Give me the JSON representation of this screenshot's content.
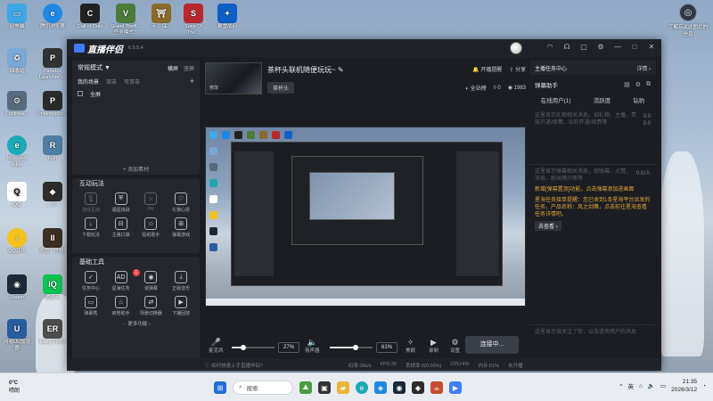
{
  "colors": {
    "accent": "#3f7cff",
    "highlight": "#e0a83a",
    "panel": "#24272e"
  },
  "desktop": {
    "icons": [
      {
        "label": "此电脑",
        "icon": "computer-icon"
      },
      {
        "label": "腾讯浏览器",
        "icon": "browser-icon"
      },
      {
        "label": "Call of Duty",
        "icon": "game-icon"
      },
      {
        "label": "Grand Theft... 任务模式...",
        "icon": "game-icon"
      },
      {
        "label": "天... 保...",
        "icon": "game-icon"
      },
      {
        "label": "Sons Of The...",
        "icon": "game-icon"
      },
      {
        "label": "暴雪战网",
        "icon": "app-icon"
      },
      {
        "label": "回收站",
        "icon": "recycle-bin-icon"
      },
      {
        "label": "Paradox Launcher v2",
        "icon": "app-icon"
      },
      {
        "label": "Controlle...",
        "icon": "app-icon"
      },
      {
        "label": "Phasmopho...",
        "icon": "game-icon"
      },
      {
        "label": "Microsoft Edge",
        "icon": "edge-icon"
      },
      {
        "label": "Raft",
        "icon": "game-icon"
      },
      {
        "label": "QQ",
        "icon": "qq-icon"
      },
      {
        "label": "... 小...",
        "icon": "app-icon"
      },
      {
        "label": "QQ音乐",
        "icon": "music-icon"
      },
      {
        "label": "天国：拯救2",
        "icon": "game-icon"
      },
      {
        "label": "Steam",
        "icon": "steam-icon"
      },
      {
        "label": "爱奇艺",
        "icon": "video-icon"
      },
      {
        "label": "网易UU加速器",
        "icon": "app-icon"
      },
      {
        "label": "Easy Red 2",
        "icon": "game-icon"
      }
    ],
    "right_icon": {
      "label": "了解有关此图片的信息",
      "icon": "camera-icon"
    }
  },
  "app": {
    "name": "直播伴侣",
    "version": "6.5.5.4",
    "window_controls": [
      "headset-icon",
      "customer-service-icon",
      "feedback-icon",
      "settings-icon",
      "minimize-icon",
      "maximize-icon",
      "close-icon"
    ]
  },
  "left": {
    "mode": "常规模式 ▼",
    "orientation": [
      "横屏",
      "竖屏"
    ],
    "scene_tabs": [
      "我的场景",
      "双击",
      "可双击"
    ],
    "scene_item": "全屏",
    "add_source": "+ 添加素材",
    "interactive_title": "互动玩法",
    "interactive_tools": [
      {
        "label": "连线互动",
        "icon": "mic-icon",
        "dim": true
      },
      {
        "label": "福星挑战",
        "icon": "shield-icon",
        "dim": false
      },
      {
        "label": "PK",
        "icon": "pk-icon",
        "dim": true
      },
      {
        "label": "礼物心愿",
        "icon": "gift-icon",
        "dim": false
      },
      {
        "label": "下载玩法",
        "icon": "download-icon",
        "dim": false
      },
      {
        "label": "主播口袋",
        "icon": "pocket-icon",
        "dim": false
      },
      {
        "label": "贴纸助手",
        "icon": "sticker-icon",
        "dim": false
      },
      {
        "label": "弹幕游戏",
        "icon": "gamepad-icon",
        "dim": false
      }
    ],
    "basic_title": "基础工具",
    "basic_tools": [
      {
        "label": "任务中心",
        "icon": "task-icon",
        "badge": ""
      },
      {
        "label": "星海任务",
        "icon": "ad-icon",
        "badge": "1"
      },
      {
        "label": "谈弹幕",
        "icon": "chat-icon",
        "badge": ""
      },
      {
        "label": "正版音乐",
        "icon": "music-download-icon",
        "badge": ""
      },
      {
        "label": "弹幕秀",
        "icon": "danmu-show-icon",
        "badge": ""
      },
      {
        "label": "房管助手",
        "icon": "admin-icon",
        "badge": ""
      },
      {
        "label": "场景切换器",
        "icon": "switch-icon",
        "badge": ""
      },
      {
        "label": "下播回放",
        "icon": "replay-icon",
        "badge": ""
      }
    ],
    "more": "··· 更多功能 ›"
  },
  "stream": {
    "title": "茶杯头联机随便玩玩~",
    "edit_cover": "修改",
    "category": "茶杯头",
    "remind": "开播提醒",
    "share": "分享",
    "all_fans": "全站榜",
    "likes": "0",
    "viewers": "1983"
  },
  "controls": {
    "mic": "麦克风",
    "mic_pct": "27%",
    "speaker": "扬声器",
    "speaker_pct": "61%",
    "beauty": "美颜",
    "record": "录制",
    "settings": "设置",
    "live_button": "连接中..."
  },
  "levels": {
    "mic": 0.27,
    "speaker": 0.61
  },
  "statusbar": {
    "help": "如何快速上手直播伴侣?",
    "bitrate": "码率:0kb/s",
    "fps": "FPS:30",
    "drop": "丢帧率:0(0.00%)",
    "cpu": "CPU:4%",
    "mem": "内存:61%",
    "live": "未开播"
  },
  "right": {
    "header": "主播任务中心",
    "details": "详情 ›",
    "danmu_title": "弹幕助手",
    "tabs": [
      "在线用户(1)",
      "活跃度",
      "钻豹"
    ],
    "gift_hint": "这里显示礼物相关消息，如礼物、主播、贵族开通/续费、钻豹开通/续费等",
    "count_a": "0.0",
    "count_b": "0.0",
    "count_c": "0.0/人",
    "chat_hint": "这里显示弹幕相关消息，如弹幕、点赞、消息、粉丝牌升等等",
    "notice1": "新增[弹幕置顶]功能，点击弹幕添加进画面",
    "notice2": "星海任务接单提醒：您已收到1条星海平台派发的任务，产品名称：风之剑舞，点击前往星海查看任务详情吧。",
    "goto": "去查看 ›",
    "follow_hint": "这里显示谁关注了你，以及进场用户的消息"
  },
  "taskbar": {
    "temp": "0°C",
    "weather": "晴朗",
    "search": "搜索",
    "ime": "英",
    "time": "21:35",
    "date": "2026/3/12"
  }
}
